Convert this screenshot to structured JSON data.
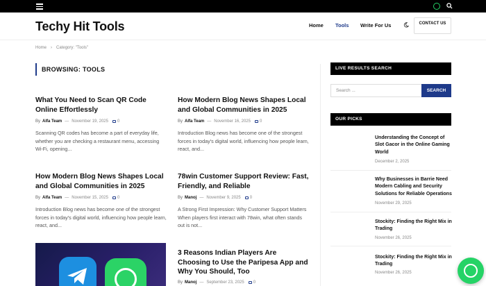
{
  "site": {
    "logo": "Techy Hit Tools"
  },
  "nav": {
    "home": "Home",
    "tools": "Tools",
    "write": "Write For Us",
    "contact": "CONTACT US"
  },
  "breadcrumb": {
    "home": "Home",
    "current": "Category: \"Tools\""
  },
  "archive": {
    "heading": "BROWSING: TOOLS"
  },
  "posts": [
    {
      "title": "What You Need to Scan QR Code Online Effortlessly",
      "by": "By",
      "author": "Alfa Team",
      "date": "November 19, 2025",
      "comments": "0",
      "excerpt": "Scanning QR codes has become a part of everyday life, whether you are checking a restaurant menu, accessing Wi-Fi, opening..."
    },
    {
      "title": "How Modern Blog News Shapes Local and Global Communities in 2025",
      "by": "By",
      "author": "Alfa Team",
      "date": "November 16, 2025",
      "comments": "0",
      "excerpt": "Introduction Blog news has become one of the strongest forces in today's digital world, influencing how people learn, react, and..."
    },
    {
      "title": "How Modern Blog News Shapes Local and Global Communities in 2025",
      "by": "By",
      "author": "Alfa Team",
      "date": "November 15, 2025",
      "comments": "0",
      "excerpt": "Introduction Blog news has become one of the strongest forces in today's digital world, influencing how people learn, react, and..."
    },
    {
      "title": "78win Customer Support Review: Fast, Friendly, and Reliable",
      "by": "By",
      "author": "Manoj",
      "date": "November 9, 2025",
      "comments": "0",
      "excerpt": "A Strong First Impression: Why Customer Support Matters When players first interact with 78win, what often stands out is not..."
    },
    {
      "title": "3 Reasons Indian Players Are Choosing to Use the Paripesa App and Why You Should, Too",
      "by": "By",
      "author": "Manoj",
      "date": "September 23, 2025",
      "comments": "0"
    }
  ],
  "sidebar": {
    "live_search": "LIVE RESULTS SEARCH",
    "search_placeholder": "Search ...",
    "search_button": "SEARCH",
    "our_picks": "OUR PICKS",
    "picks": [
      {
        "title": "Understanding the Concept of Slot Gacor in the Online Gaming World",
        "date": "December 2, 2025"
      },
      {
        "title": "Why Businesses in Barrie Need Modern Cabling and Security Solutions for Reliable Operations",
        "date": "November 29, 2025"
      },
      {
        "title": "Stockity: Finding the Right Mix in Trading",
        "date": "November 26, 2025"
      },
      {
        "title": "Stockity: Finding the Right Mix in Trading",
        "date": "November 26, 2025"
      }
    ]
  },
  "colors": {
    "accent": "#1e3a8a",
    "whatsapp": "#25d366"
  },
  "icons": [
    "menu-icon",
    "whatsapp-icon",
    "search-icon",
    "moon-icon",
    "comment-icon"
  ]
}
